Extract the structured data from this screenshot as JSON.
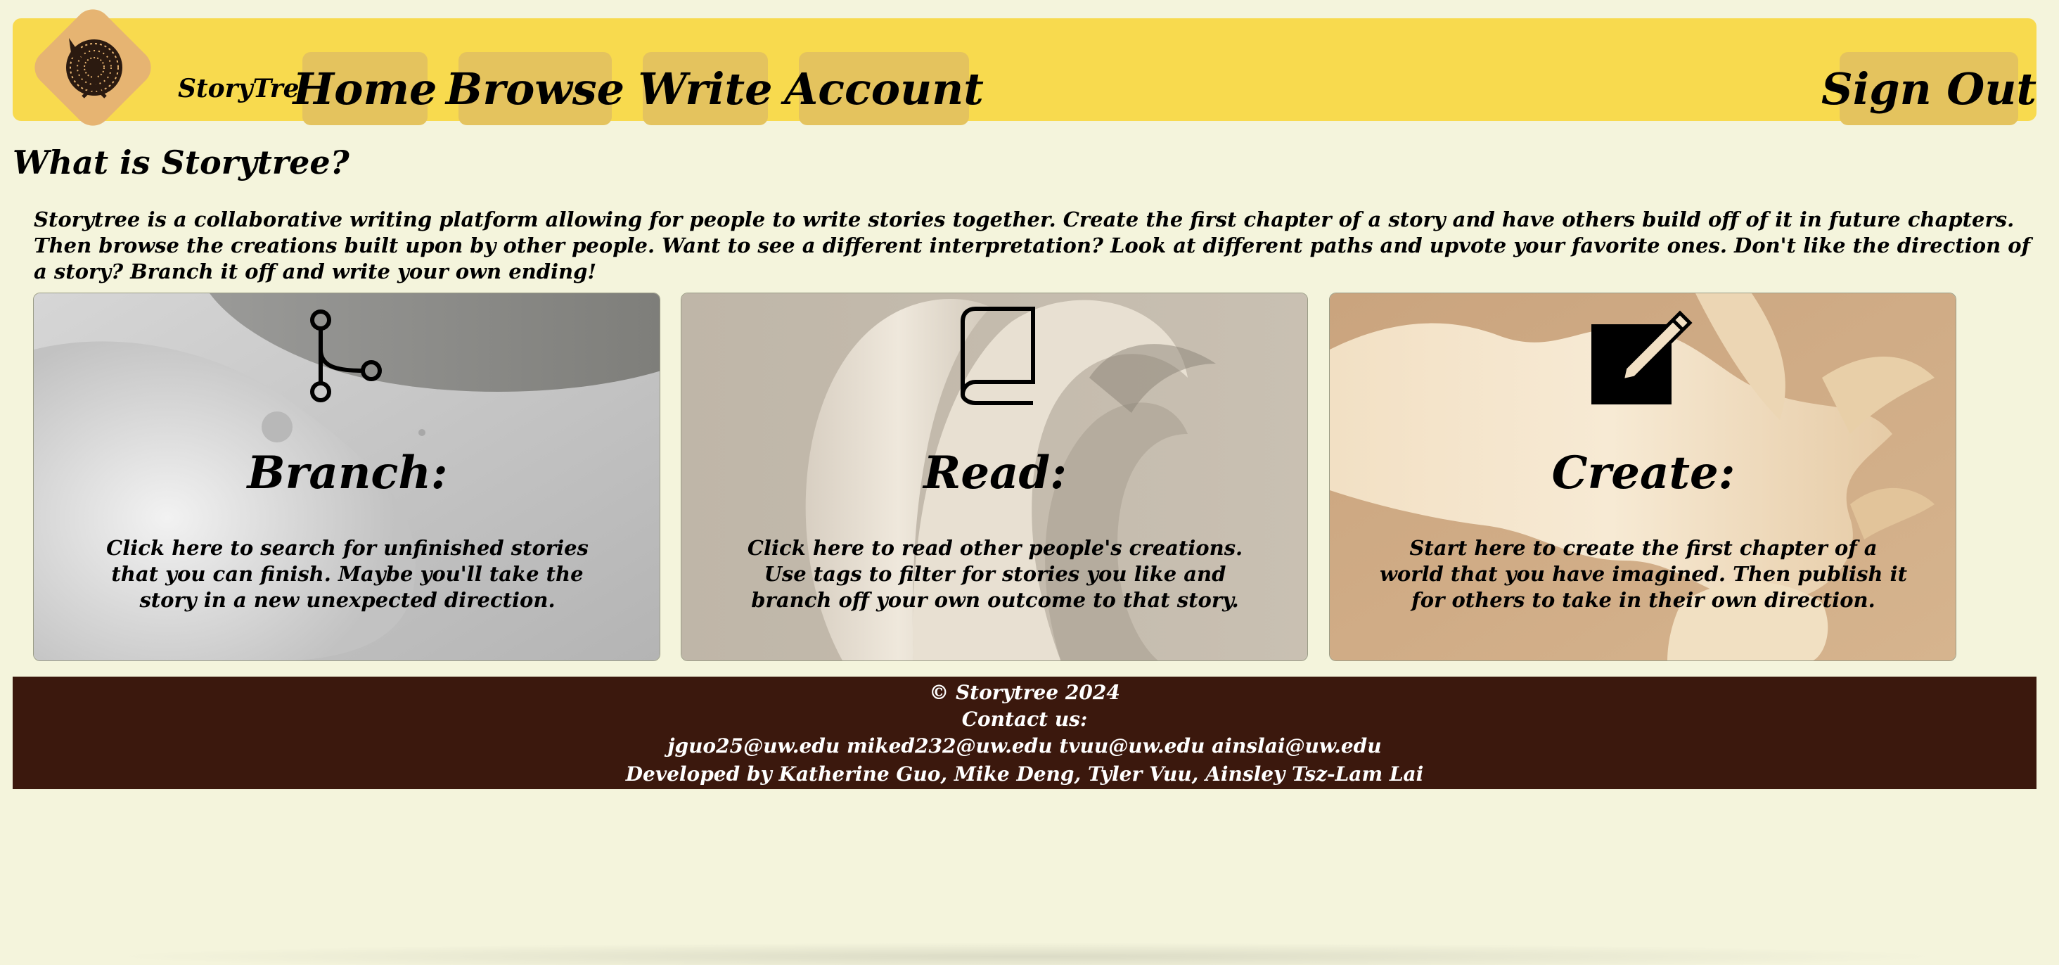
{
  "nav": {
    "brand": "StoryTree",
    "links": [
      "Home",
      "Browse",
      "Write",
      "Account"
    ],
    "sign_out": "Sign Out",
    "logo_icon": "tree-logo-icon"
  },
  "main": {
    "heading": "What is Storytree?",
    "intro": "Storytree is a collaborative writing platform allowing for people to write stories together. Create the first chapter of a story and have others build off of it in future chapters. Then browse the creations built upon by other people. Want to see a different interpretation? Look at different paths and upvote your favorite ones. Don't like the direction of a story? Branch it off and write your own ending!"
  },
  "cards": [
    {
      "title": "Branch:",
      "text": "Click here to search for unfinished stories that you can finish. Maybe you'll take the story in a new unexpected direction.",
      "icon": "branch-icon"
    },
    {
      "title": "Read:",
      "text": "Click here to read other people's creations. Use tags to filter for stories you like and branch off your own outcome to that story.",
      "icon": "book-icon"
    },
    {
      "title": "Create:",
      "text": "Start here to create the first chapter of a world that you have imagined. Then publish it for others to take in their own direction.",
      "icon": "pencil-square-icon"
    }
  ],
  "footer": {
    "copyright": "© Storytree 2024",
    "contact_label": "Contact us:",
    "emails": "jguo25@uw.edu miked232@uw.edu tvuu@uw.edu ainslai@uw.edu",
    "developers": "Developed by Katherine Guo, Mike Deng, Tyler Vuu, Ainsley Tsz-Lam Lai"
  },
  "colors": {
    "page_bg": "#f4f4dc",
    "navbar_bg": "#f8da4e",
    "nav_button_bg": "#e4c35e",
    "logo_bg": "#e6b472",
    "footer_bg": "#3b180d"
  }
}
